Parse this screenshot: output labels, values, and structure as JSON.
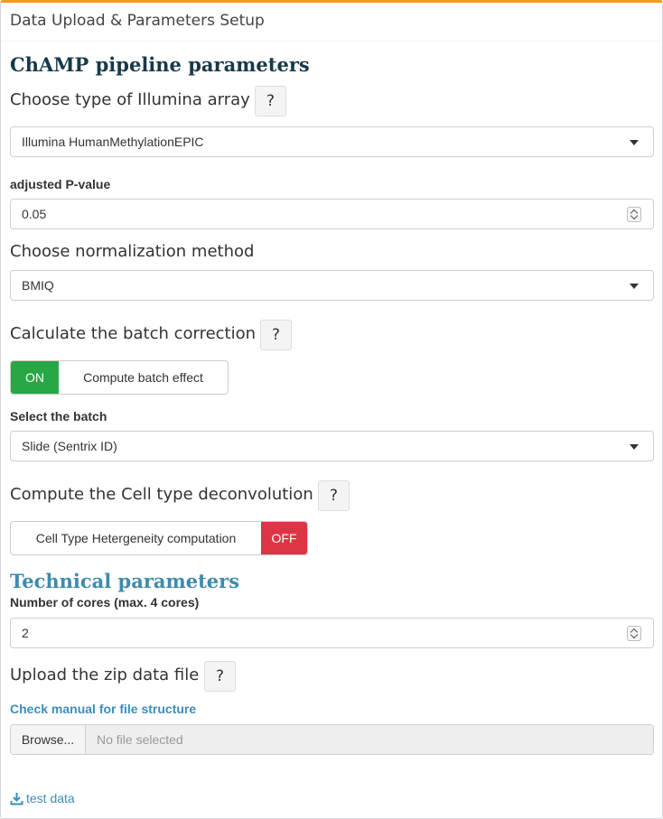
{
  "header": {
    "title": "Data Upload & Parameters Setup"
  },
  "champ_section": {
    "title": "ChAMP pipeline parameters"
  },
  "array_type": {
    "label": "Choose type of Illumina array",
    "help": "?",
    "selected": "Illumina HumanMethylationEPIC"
  },
  "pvalue": {
    "label": "adjusted P-value",
    "value": "0.05"
  },
  "normalization": {
    "label": "Choose normalization method",
    "selected": "BMIQ"
  },
  "batch_correction": {
    "label": "Calculate the batch correction",
    "help": "?",
    "switch_state": "ON",
    "switch_label": "Compute batch effect"
  },
  "batch_select": {
    "label": "Select the batch",
    "selected": "Slide (Sentrix ID)"
  },
  "deconvolution": {
    "label": "Compute the Cell type deconvolution",
    "help": "?",
    "switch_label": "Cell Type Hetergeneity computation",
    "switch_state": "OFF"
  },
  "technical_section": {
    "title": "Technical parameters"
  },
  "cores": {
    "label": "Number of cores (max. 4 cores)",
    "value": "2"
  },
  "upload": {
    "label": "Upload the zip data file",
    "help": "?",
    "manual_link": "Check manual for file structure",
    "browse_label": "Browse...",
    "file_placeholder": "No file selected"
  },
  "download": {
    "label": "test data"
  },
  "colors": {
    "accent_top": "#f39c12",
    "on_green": "#28a745",
    "off_red": "#dc3545",
    "link_blue": "#3c8dbc",
    "section_title_dark": "#17394a",
    "section_title_blue": "#3d8bab"
  },
  "icons": {
    "download": "download-icon",
    "dropdown": "caret-down-icon",
    "spinner": "spinner-icon"
  }
}
